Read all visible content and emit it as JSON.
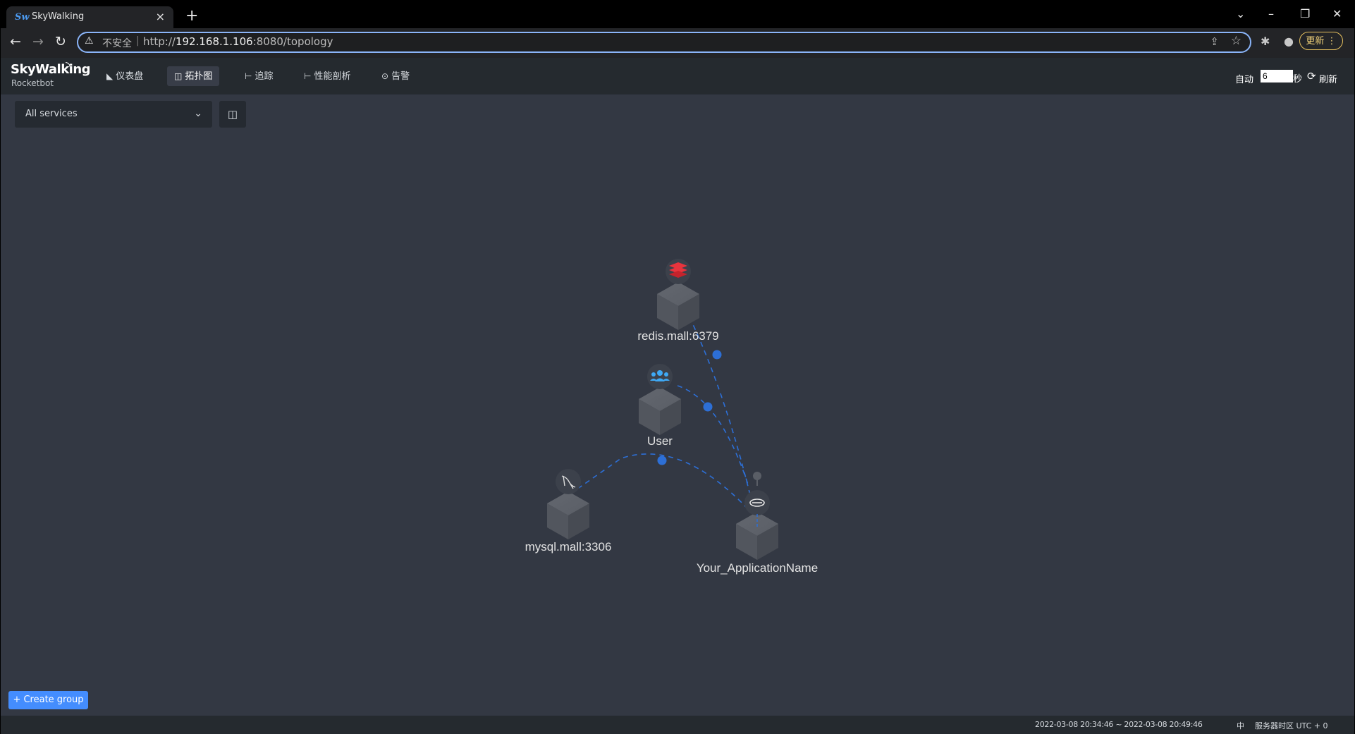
{
  "browser": {
    "tab_title": "SkyWalking",
    "tab_close": "×",
    "new_tab": "+",
    "window_controls": {
      "tabsearch": "⌄",
      "minimize": "–",
      "restore": "❐",
      "close": "✕"
    },
    "insecure_label": "不安全",
    "url_prefix": "http://",
    "url_host": "192.168.1.106",
    "url_path": ":8080/topology",
    "update_button": "更新 ⋮"
  },
  "app": {
    "logo": "SkyWalking",
    "logo_sub": "Rocketbot",
    "nav": [
      {
        "label": "仪表盘",
        "icon": "dashboard-icon",
        "glyph": "◣"
      },
      {
        "label": "拓扑图",
        "icon": "topology-icon",
        "glyph": "◫"
      },
      {
        "label": "追踪",
        "icon": "trace-icon",
        "glyph": "⊢"
      },
      {
        "label": "性能剖析",
        "icon": "profile-icon",
        "glyph": "⊢"
      },
      {
        "label": "告警",
        "icon": "alarm-icon",
        "glyph": "⊙"
      }
    ],
    "active_nav": "拓扑图",
    "auto_label": "自动",
    "interval_value": "6",
    "seconds_label": "秒",
    "refresh_label": "刷新"
  },
  "filter": {
    "service_selected": "All services"
  },
  "topology": {
    "nodes": [
      {
        "name": "redis.mall:6379",
        "type": "redis",
        "icon": "redis-icon",
        "color": "#e8343d"
      },
      {
        "name": "User",
        "type": "user",
        "icon": "user-group-icon",
        "color": "#3fa9f5"
      },
      {
        "name": "mysql.mall:3306",
        "type": "mysql",
        "icon": "mysql-icon",
        "color": "#d9d9d9"
      },
      {
        "name": "Your_ApplicationName",
        "type": "service",
        "icon": "spring-icon",
        "color": "#d9d9d9"
      }
    ],
    "edges": [
      {
        "source": "User",
        "target": "Your_ApplicationName"
      },
      {
        "source": "Your_ApplicationName",
        "target": "redis.mall:6379"
      },
      {
        "source": "Your_ApplicationName",
        "target": "mysql.mall:3306"
      }
    ],
    "edge_color": "#2d6fd6"
  },
  "actions": {
    "create_group": "+ Create group"
  },
  "footer": {
    "time_range": "2022-03-08 20:34:46 ~ 2022-03-08 20:49:46",
    "lang": "中",
    "timezone": "服务器时区 UTC + 0"
  }
}
